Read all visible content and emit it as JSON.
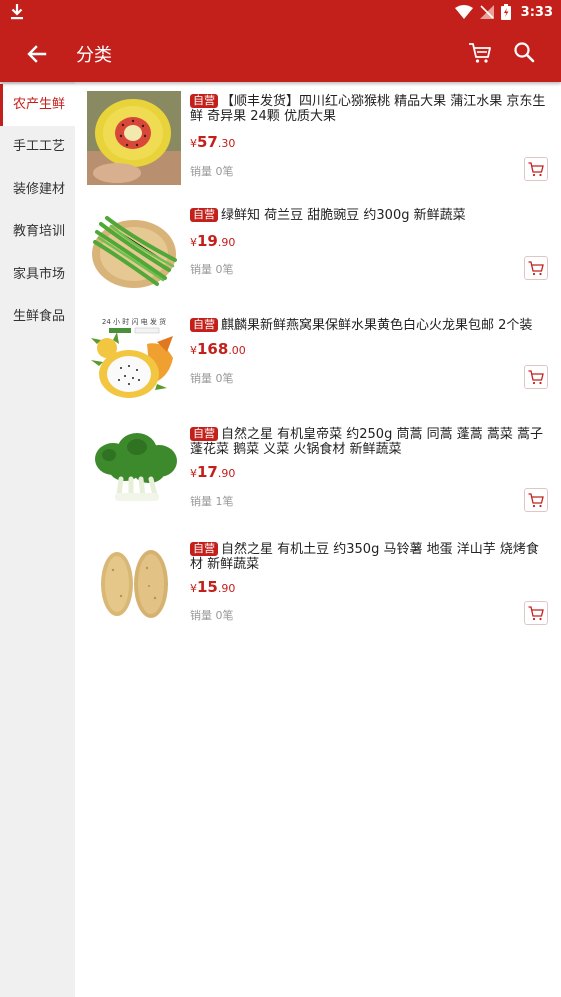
{
  "status_bar": {
    "time": "3:33"
  },
  "header": {
    "title": "分类"
  },
  "sidebar": {
    "items": [
      {
        "label": "农产生鲜",
        "active": true
      },
      {
        "label": "手工工艺"
      },
      {
        "label": "装修建材"
      },
      {
        "label": "教育培训"
      },
      {
        "label": "家具市场"
      },
      {
        "label": "生鲜食品"
      }
    ]
  },
  "products": [
    {
      "badge": "自营",
      "title": "【顺丰发货】四川红心猕猴桃 精品大果 蒲江水果 京东生鲜 奇异果 24颗 优质大果",
      "currency": "¥",
      "price_int": "57",
      "price_dec": ".30",
      "sales": "销量 0笔",
      "image": "kiwi"
    },
    {
      "badge": "自营",
      "title": "绿鲜知 荷兰豆 甜脆豌豆 约300g 新鲜蔬菜",
      "currency": "¥",
      "price_int": "19",
      "price_dec": ".90",
      "sales": "销量 0笔",
      "image": "peas"
    },
    {
      "badge": "自营",
      "title": "麒麟果新鲜燕窝果保鲜水果黄色白心火龙果包邮 2个装",
      "currency": "¥",
      "price_int": "168",
      "price_dec": ".00",
      "sales": "销量 0笔",
      "image": "dragonfruit",
      "image_caption": "24 小 时 闪 电 发 货"
    },
    {
      "badge": "自营",
      "title": "自然之星 有机皇帝菜 约250g 茼蒿 同蒿 蓬蒿 蒿菜 蒿子 蓬花菜 鹅菜 义菜 火锅食材 新鲜蔬菜",
      "currency": "¥",
      "price_int": "17",
      "price_dec": ".90",
      "sales": "销量 1笔",
      "image": "greens"
    },
    {
      "badge": "自营",
      "title": "自然之星 有机土豆 约350g 马铃薯 地蛋 洋山芋 烧烤食材 新鲜蔬菜",
      "currency": "¥",
      "price_int": "15",
      "price_dec": ".90",
      "sales": "销量 0笔",
      "image": "potato"
    }
  ],
  "colors": {
    "primary": "#c4201b",
    "sidebar_bg": "#f0f0f0"
  }
}
